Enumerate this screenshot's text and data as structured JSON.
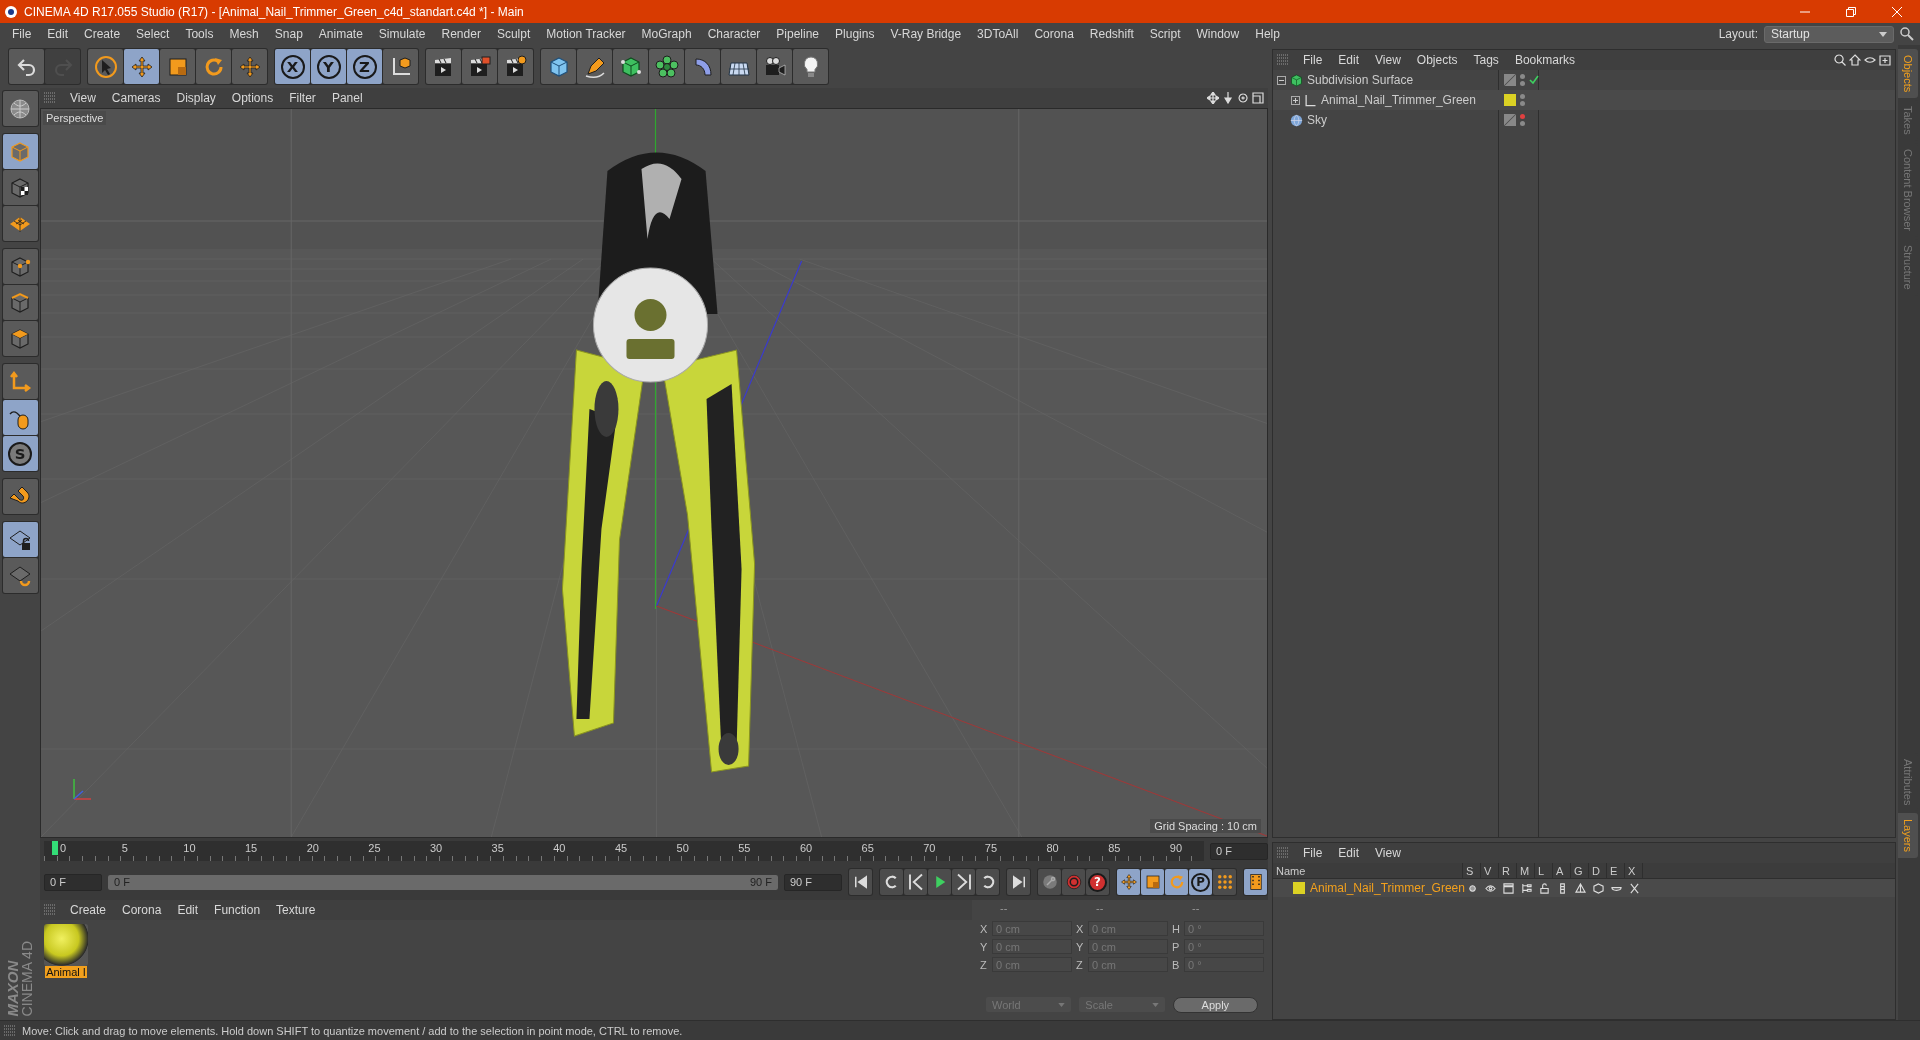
{
  "title_bar": {
    "title": "CINEMA 4D R17.055 Studio (R17) - [Animal_Nail_Trimmer_Green_c4d_standart.c4d *] - Main"
  },
  "menu_bar": {
    "items": [
      "File",
      "Edit",
      "Create",
      "Select",
      "Tools",
      "Mesh",
      "Snap",
      "Animate",
      "Simulate",
      "Render",
      "Sculpt",
      "Motion Tracker",
      "MoGraph",
      "Character",
      "Pipeline",
      "Plugins",
      "V-Ray Bridge",
      "3DToAll",
      "Corona",
      "Redshift",
      "Script",
      "Window",
      "Help"
    ],
    "layout_label": "Layout:",
    "layout_value": "Startup"
  },
  "toolbar": {
    "groups": [
      [
        {
          "kind": "undo-arrow",
          "selected": false,
          "disabled": false
        },
        {
          "kind": "redo-arrow",
          "selected": false,
          "disabled": true
        }
      ],
      [
        {
          "kind": "cursor",
          "selected": false
        },
        {
          "kind": "move-arrows",
          "selected": true
        },
        {
          "kind": "scale-square",
          "selected": false
        },
        {
          "kind": "rotate-arrows",
          "selected": false
        },
        {
          "kind": "cross-arrows",
          "selected": false
        }
      ],
      [
        {
          "kind": "axis-letter",
          "label": "X",
          "selected": true
        },
        {
          "kind": "axis-letter",
          "label": "Y",
          "selected": true
        },
        {
          "kind": "axis-letter",
          "label": "Z",
          "selected": true
        },
        {
          "kind": "axes-cube",
          "selected": false
        }
      ],
      [
        {
          "kind": "clapper",
          "selected": false
        },
        {
          "kind": "clapper-play",
          "selected": false
        },
        {
          "kind": "clapper-gear",
          "selected": false
        }
      ],
      [
        {
          "kind": "cube",
          "selected": false
        },
        {
          "kind": "pen",
          "selected": false
        },
        {
          "kind": "cube-frame",
          "selected": false
        },
        {
          "kind": "flower",
          "selected": false
        },
        {
          "kind": "bent-shape",
          "selected": false
        },
        {
          "kind": "grid-plane",
          "selected": false
        },
        {
          "kind": "camera",
          "selected": false
        },
        {
          "kind": "lightbulb",
          "selected": false
        }
      ]
    ]
  },
  "left_tools": {
    "groups": [
      [
        {
          "kind": "globe-grid",
          "selected": false
        }
      ],
      [
        {
          "kind": "cube-outline",
          "selected": true
        },
        {
          "kind": "checker-cube",
          "selected": false
        },
        {
          "kind": "diamond-grid",
          "selected": false
        }
      ],
      [
        {
          "kind": "cube-points",
          "selected": false
        },
        {
          "kind": "cube-edges",
          "selected": false
        },
        {
          "kind": "cube-face",
          "selected": false
        }
      ],
      [
        {
          "kind": "axis-corner",
          "selected": false
        },
        {
          "kind": "mouse",
          "selected": true
        },
        {
          "kind": "snap-letter",
          "label": "S",
          "selected": true
        }
      ],
      [
        {
          "kind": "magnet",
          "selected": false
        }
      ],
      [
        {
          "kind": "grid-lock",
          "selected": true
        },
        {
          "kind": "grid-rotate",
          "selected": false
        }
      ]
    ]
  },
  "logo": {
    "brand": "MAXON",
    "product": "CINEMA 4D"
  },
  "viewport": {
    "menu": [
      "View",
      "Cameras",
      "Display",
      "Options",
      "Filter",
      "Panel"
    ],
    "camera": "Perspective",
    "grid_spacing": "Grid Spacing : 10 cm"
  },
  "timeline": {
    "ticks": [
      "0",
      "5",
      "10",
      "15",
      "20",
      "25",
      "30",
      "35",
      "40",
      "45",
      "50",
      "55",
      "60",
      "65",
      "70",
      "75",
      "80",
      "85",
      "90"
    ],
    "level": 0,
    "frame_field": "0 F",
    "start_field": "0 F",
    "range": {
      "start": "0 F",
      "end": "90 F",
      "level": 1
    },
    "end_field": "90 F",
    "controls": [
      [
        {
          "kind": "skip-start",
          "selected": false
        }
      ],
      [
        {
          "kind": "loop-back",
          "selected": false
        },
        {
          "kind": "step-back",
          "selected": false
        },
        {
          "kind": "play",
          "selected": false
        },
        {
          "kind": "step-forward",
          "selected": false
        },
        {
          "kind": "loop-forward",
          "selected": false
        }
      ],
      [
        {
          "kind": "skip-end",
          "selected": false
        }
      ],
      [
        {
          "kind": "key-disabled",
          "selected": false
        },
        {
          "kind": "record",
          "selected": false
        },
        {
          "kind": "help-letter",
          "label": "?",
          "selected": false
        }
      ],
      [
        {
          "kind": "move-arrows",
          "selected": true
        },
        {
          "kind": "scale-square",
          "selected": true
        },
        {
          "kind": "rotate-arrows",
          "selected": true
        },
        {
          "kind": "key-letter",
          "label": "P",
          "selected": true
        },
        {
          "kind": "dots-grid",
          "selected": false
        }
      ],
      [
        {
          "kind": "film-strip",
          "selected": true
        }
      ]
    ]
  },
  "materials": {
    "menu": [
      "Create",
      "Corona",
      "Edit",
      "Function",
      "Texture"
    ],
    "items": [
      {
        "name": "Animal I",
        "selected": true
      }
    ]
  },
  "coordinates": {
    "headers": [
      "--",
      "--",
      "--"
    ],
    "columns": [
      [
        {
          "axis": "X",
          "value": "0 cm"
        },
        {
          "axis": "Y",
          "value": "0 cm"
        },
        {
          "axis": "Z",
          "value": "0 cm"
        }
      ],
      [
        {
          "axis": "X",
          "value": "0 cm"
        },
        {
          "axis": "Y",
          "value": "0 cm"
        },
        {
          "axis": "Z",
          "value": "0 cm"
        }
      ],
      [
        {
          "axis": "H",
          "value": "0 °"
        },
        {
          "axis": "P",
          "value": "0 °"
        },
        {
          "axis": "B",
          "value": "0 °"
        }
      ]
    ],
    "dropdowns": [
      "World",
      "Scale"
    ],
    "apply": "Apply"
  },
  "object_manager": {
    "menu": [
      "File",
      "Edit",
      "View",
      "Objects",
      "Tags",
      "Bookmarks"
    ],
    "objects": [
      {
        "name": "Subdivision Surface",
        "kind": "subdivision",
        "expanded": true,
        "enabled": true,
        "editor_visible": true,
        "children": [
          {
            "name": "Animal_Nail_Trimmer_Green",
            "kind": "null",
            "expanded": false,
            "enabled": false,
            "editor_visible": true,
            "color": "#dcd224"
          }
        ]
      },
      {
        "name": "Sky",
        "kind": "sky",
        "enabled": false,
        "editor_visible": false
      }
    ]
  },
  "layer_manager": {
    "menu": [
      "File",
      "Edit",
      "View"
    ],
    "columns": [
      "Name",
      "S",
      "V",
      "R",
      "M",
      "L",
      "A",
      "G",
      "D",
      "E",
      "X"
    ],
    "rows": [
      {
        "name": "Animal_Nail_Trimmer_Green",
        "color": "#dcd224",
        "selected": true
      }
    ]
  },
  "side_tabs": {
    "top": [
      {
        "label": "Objects",
        "selected": true
      },
      {
        "label": "Takes",
        "selected": false
      },
      {
        "label": "Content Browser",
        "selected": false
      },
      {
        "label": "Structure",
        "selected": false
      }
    ],
    "bottom": [
      {
        "label": "Attributes",
        "selected": false
      },
      {
        "label": "Layers",
        "selected": true
      }
    ]
  },
  "status_bar": {
    "text": "Move: Click and drag to move elements. Hold down SHIFT to quantize movement / add to the selection in point mode, CTRL to remove."
  }
}
